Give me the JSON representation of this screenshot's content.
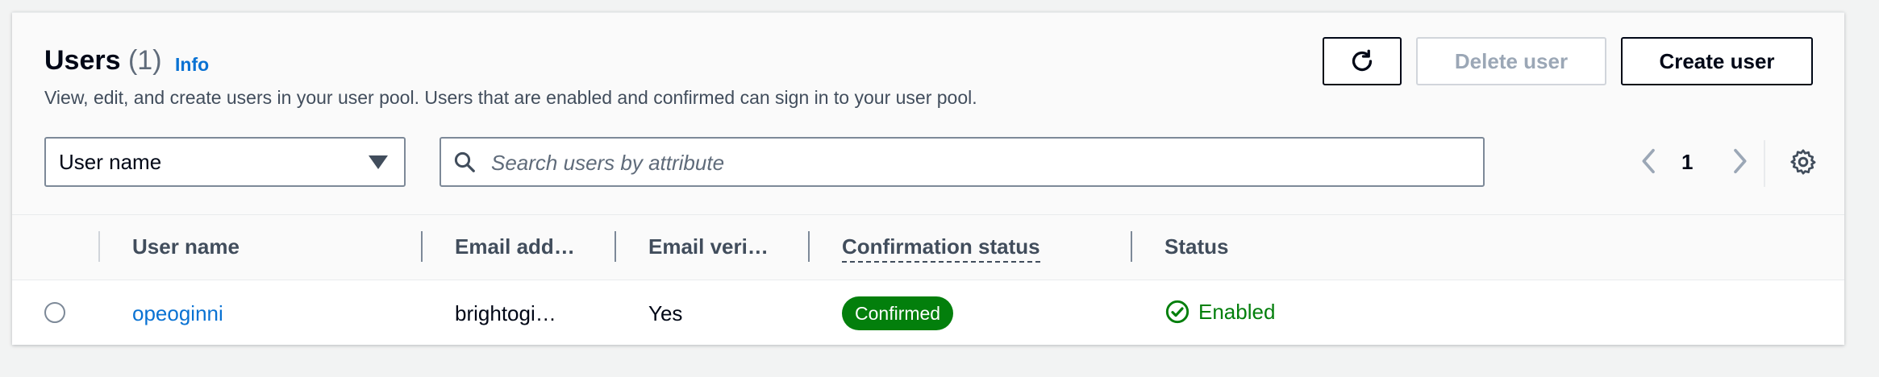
{
  "header": {
    "title": "Users",
    "count": "(1)",
    "info_link": "Info",
    "description": "View, edit, and create users in your user pool. Users that are enabled and confirmed can sign in to your user pool."
  },
  "actions": {
    "refresh_icon": "refresh-icon",
    "delete_label": "Delete user",
    "create_label": "Create user"
  },
  "filter": {
    "attribute_selected": "User name",
    "search_placeholder": "Search users by attribute"
  },
  "pagination": {
    "current_page": "1"
  },
  "table": {
    "columns": [
      "User name",
      "Email add…",
      "Email veri…",
      "Confirmation status",
      "Status"
    ],
    "rows": [
      {
        "user_name": "opeoginni",
        "email": "brightogi…",
        "email_verified": "Yes",
        "confirmation_status": "Confirmed",
        "status": "Enabled"
      }
    ]
  },
  "colors": {
    "link": "#0972d3",
    "success": "#037f0c",
    "disabled": "#9ba7b6"
  }
}
